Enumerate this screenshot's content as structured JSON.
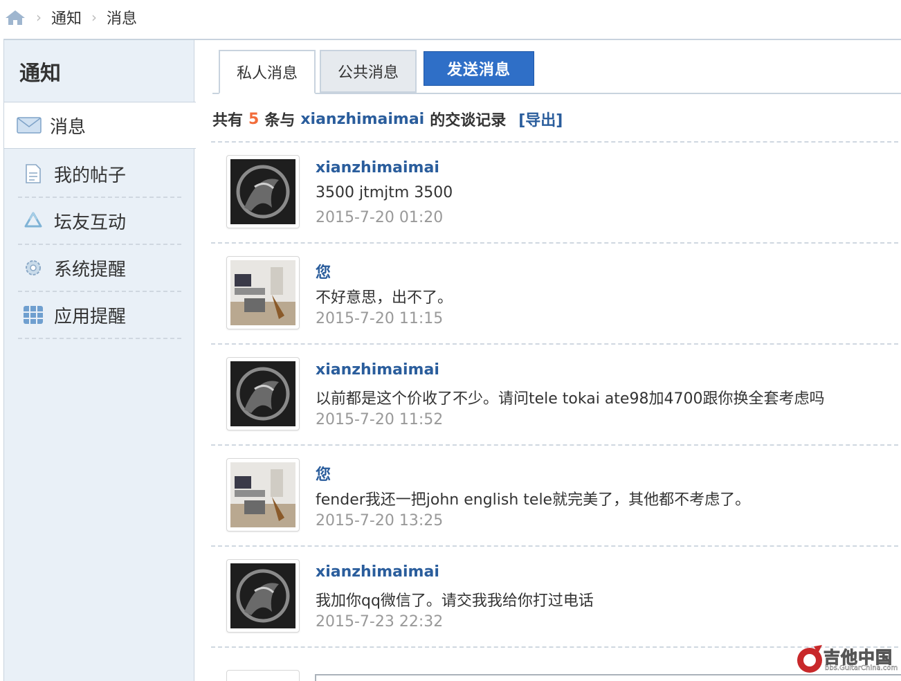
{
  "breadcrumb": {
    "items": [
      "通知",
      "消息"
    ]
  },
  "sidebar": {
    "title": "通知",
    "active_item": {
      "label": "消息",
      "icon": "envelope-icon"
    },
    "items": [
      {
        "label": "我的帖子",
        "icon": "document-icon"
      },
      {
        "label": "坛友互动",
        "icon": "recycle-icon"
      },
      {
        "label": "系统提醒",
        "icon": "gear-icon"
      },
      {
        "label": "应用提醒",
        "icon": "grid-icon"
      }
    ]
  },
  "tabs": {
    "private": "私人消息",
    "public": "公共消息",
    "send": "发送消息"
  },
  "summary": {
    "prefix": "共有",
    "count": "5",
    "middle": "条与",
    "user": "xianzhimaimai",
    "suffix": "的交谈记录",
    "export": "[导出]"
  },
  "messages": [
    {
      "sender": "xianzhimaimai",
      "text": "3500 jtmjtm 3500",
      "time": "2015-7-20 01:20",
      "avatar": "dragon"
    },
    {
      "sender": "您",
      "text": "不好意思，出不了。",
      "time": "2015-7-20 11:15",
      "avatar": "room"
    },
    {
      "sender": "xianzhimaimai",
      "text": "以前都是这个价收了不少。请问tele tokai ate98加4700跟你换全套考虑吗",
      "time": "2015-7-20 11:52",
      "avatar": "dragon"
    },
    {
      "sender": "您",
      "text": "fender我还一把john english tele就完美了，其他都不考虑了。",
      "time": "2015-7-20 13:25",
      "avatar": "room"
    },
    {
      "sender": "xianzhimaimai",
      "text": "我加你qq微信了。请交我我给你打过电话",
      "time": "2015-7-23 22:32",
      "avatar": "dragon"
    }
  ],
  "watermark": {
    "title": "吉他中国",
    "url": "bbs.GuitarChina.com"
  },
  "colors": {
    "link": "#2a5d9c",
    "count": "#f26c3a",
    "button": "#2f6fc7",
    "sidebar_bg": "#e9f0f7"
  }
}
